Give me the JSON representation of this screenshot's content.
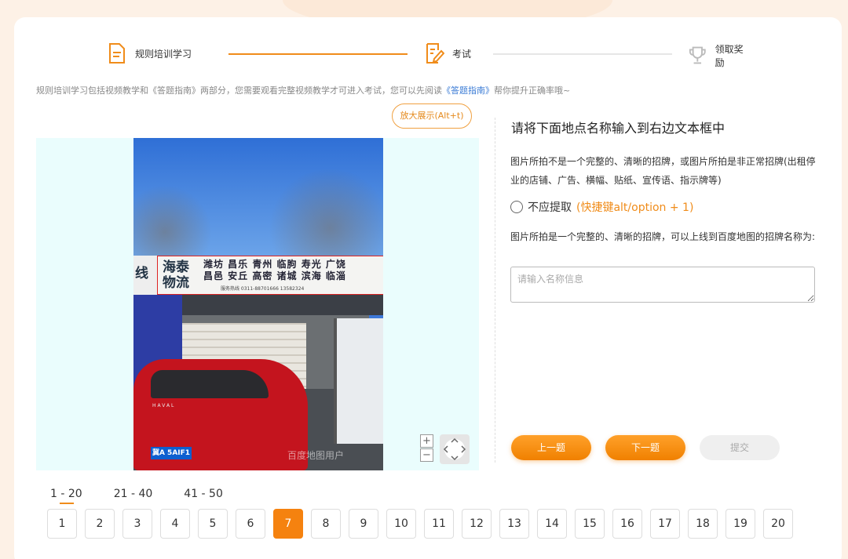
{
  "steps": [
    {
      "label": "规则培训学习",
      "icon": "document-icon",
      "color": "#f08c1a"
    },
    {
      "label": "考试",
      "icon": "edit-document-icon",
      "color": "#f08c1a"
    },
    {
      "label": "领取奖励",
      "icon": "trophy-icon",
      "color": "#bbbbbb"
    }
  ],
  "description": {
    "text_before": "规则培训学习包括视频教学和《答题指南》两部分，您需要观看完整视频教学才可进入考试，您可以先阅读",
    "link": "《答题指南》",
    "text_after": "帮你提升正确率哦~"
  },
  "viewer": {
    "zoom_button": "放大展示(Alt+t)",
    "zoom_in": "+",
    "zoom_out": "−",
    "watermark": "百度地图用户",
    "sign_left": "海泰物流",
    "sign_edge": "线",
    "sign_rows": [
      "潍坊 昌乐 青州 临朐 寿光 广饶",
      "昌邑 安丘 高密 诸城 滨海 临淄"
    ],
    "sign_phone": "服务热线 0311-88701666 13582324",
    "car_brand": "HAVAL",
    "plate": "冀A 5AIF1"
  },
  "question": {
    "title": "请将下面地点名称输入到右边文本框中",
    "text1": "图片所拍不是一个完整的、清晰的招牌，或图片所拍是非正常招牌(出租停业的店铺、广告、横幅、贴纸、宣传语、指示牌等)",
    "radio_label": "不应提取",
    "radio_hint": "(快捷键alt/option + 1)",
    "text2": "图片所拍是一个完整的、清晰的招牌，可以上线到百度地图的招牌名称为:",
    "input_placeholder": "请输入名称信息",
    "input_value": ""
  },
  "buttons": {
    "prev": "上一题",
    "next": "下一题",
    "submit": "提交"
  },
  "pagination": {
    "ranges": [
      "1 - 20",
      "21 - 40",
      "41 - 50"
    ],
    "active_range": 0,
    "pages": [
      "1",
      "2",
      "3",
      "4",
      "5",
      "6",
      "7",
      "8",
      "9",
      "10",
      "11",
      "12",
      "13",
      "14",
      "15",
      "16",
      "17",
      "18",
      "19",
      "20"
    ],
    "current_page": "7"
  },
  "colors": {
    "accent": "#f08c1a",
    "link": "#3a7bd5",
    "viewer_bg": "#eafdfd"
  }
}
